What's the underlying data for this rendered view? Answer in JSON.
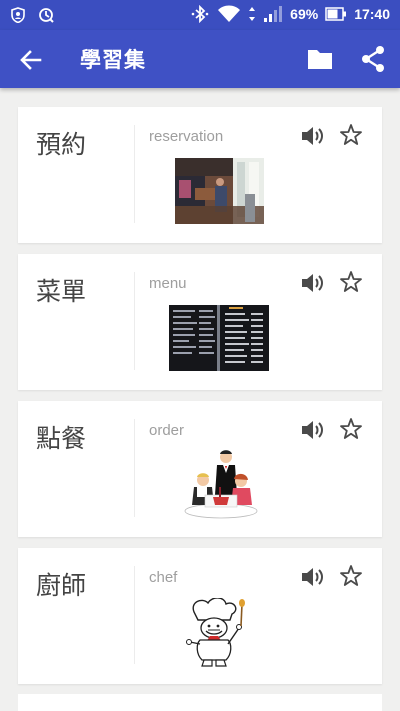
{
  "status_bar": {
    "battery": "69%",
    "time": "17:40"
  },
  "app_bar": {
    "title": "學習集"
  },
  "colors": {
    "status_bar": "#3b4ec0",
    "app_bar": "#3f51c5",
    "background": "#f0f0ef",
    "icon_gray": "#4a4a4a"
  },
  "cards": [
    {
      "term": "預約",
      "definition": "reservation",
      "image": "restaurant-interior-photo"
    },
    {
      "term": "菜單",
      "definition": "menu",
      "image": "menu-board-photo"
    },
    {
      "term": "點餐",
      "definition": "order",
      "image": "waiter-serving-diners-clipart"
    },
    {
      "term": "廚師",
      "definition": "chef",
      "image": "chef-cartoon-clipart"
    }
  ]
}
